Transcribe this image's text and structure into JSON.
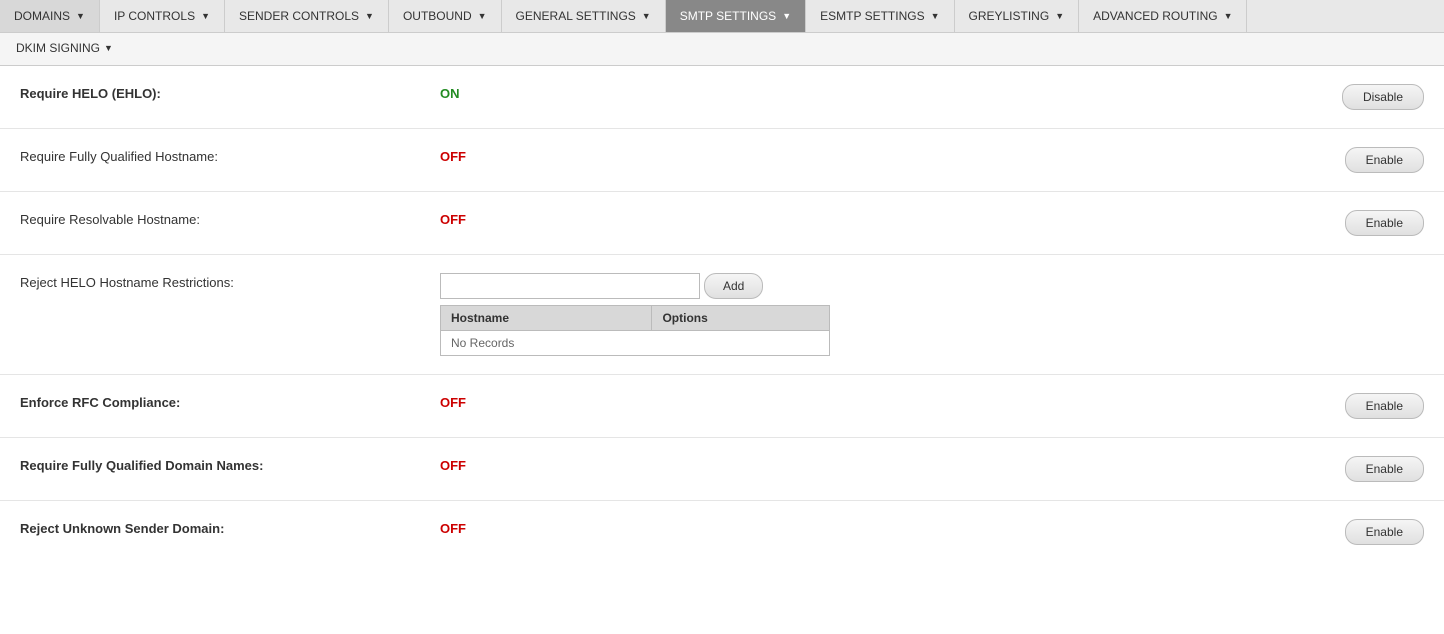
{
  "nav": {
    "items": [
      {
        "label": "DOMAINS",
        "id": "domains",
        "active": false
      },
      {
        "label": "IP CONTROLS",
        "id": "ip-controls",
        "active": false
      },
      {
        "label": "SENDER CONTROLS",
        "id": "sender-controls",
        "active": false
      },
      {
        "label": "OUTBOUND",
        "id": "outbound",
        "active": false
      },
      {
        "label": "GENERAL SETTINGS",
        "id": "general-settings",
        "active": false
      },
      {
        "label": "SMTP SETTINGS",
        "id": "smtp-settings",
        "active": true
      },
      {
        "label": "ESMTP SETTINGS",
        "id": "esmtp-settings",
        "active": false
      },
      {
        "label": "GREYLISTING",
        "id": "greylisting",
        "active": false
      },
      {
        "label": "ADVANCED ROUTING",
        "id": "advanced-routing",
        "active": false
      }
    ]
  },
  "subnav": {
    "items": [
      {
        "label": "DKIM SIGNING",
        "id": "dkim-signing"
      }
    ]
  },
  "settings": [
    {
      "id": "require-helo",
      "label": "Require HELO (EHLO):",
      "bold": true,
      "value": "ON",
      "value_class": "on",
      "action_label": "Disable",
      "has_table": false
    },
    {
      "id": "require-fqhn",
      "label": "Require Fully Qualified Hostname:",
      "bold": false,
      "value": "OFF",
      "value_class": "off",
      "action_label": "Enable",
      "has_table": false
    },
    {
      "id": "require-resolvable",
      "label": "Require Resolvable Hostname:",
      "bold": false,
      "value": "OFF",
      "value_class": "off",
      "action_label": "Enable",
      "has_table": false
    },
    {
      "id": "reject-helo",
      "label": "Reject HELO Hostname Restrictions:",
      "bold": false,
      "value": "",
      "value_class": "",
      "action_label": "",
      "has_table": true,
      "table": {
        "add_button": "Add",
        "col_hostname": "Hostname",
        "col_options": "Options",
        "no_records": "No Records"
      }
    },
    {
      "id": "enforce-rfc",
      "label": "Enforce RFC Compliance:",
      "bold": true,
      "value": "OFF",
      "value_class": "off",
      "action_label": "Enable",
      "has_table": false
    },
    {
      "id": "require-fqdn",
      "label": "Require Fully Qualified Domain Names:",
      "bold": true,
      "value": "OFF",
      "value_class": "off",
      "action_label": "Enable",
      "has_table": false
    },
    {
      "id": "reject-unknown-sender",
      "label": "Reject Unknown Sender Domain:",
      "bold": true,
      "value": "OFF",
      "value_class": "off",
      "action_label": "Enable",
      "has_table": false
    }
  ]
}
